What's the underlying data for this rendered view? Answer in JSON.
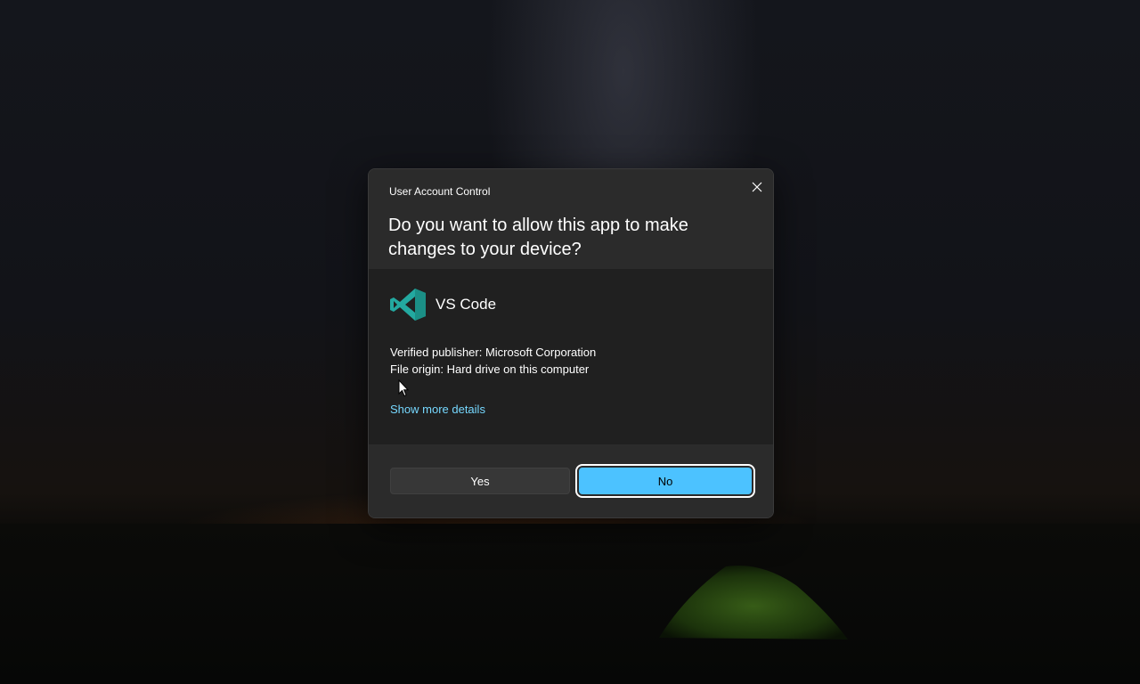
{
  "dialog": {
    "caption": "User Account Control",
    "question": "Do you want to allow this app to make changes to your device?",
    "close_icon": "close-icon",
    "app": {
      "name": "VS Code",
      "icon": "vscode-logo-icon",
      "icon_color": "#23a9a0"
    },
    "details": {
      "publisher": "Verified publisher: Microsoft Corporation",
      "origin": "File origin: Hard drive on this computer"
    },
    "more_details_link": "Show more details",
    "buttons": {
      "yes_label": "Yes",
      "no_label": "No"
    }
  },
  "colors": {
    "accent": "#4cc2ff",
    "link": "#76d8ff",
    "dialog_background": "#202020",
    "panel_background": "#2b2b2b"
  }
}
